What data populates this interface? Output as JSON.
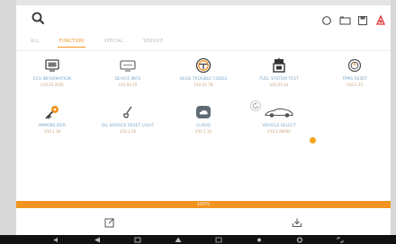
{
  "accent_color": "#f29422",
  "topbar": {
    "search_icon": "search-icon",
    "actions": [
      "refresh-icon",
      "folder-icon",
      "save-icon",
      "pdf-icon"
    ]
  },
  "tabs": [
    {
      "label": "ALL",
      "active": false
    },
    {
      "label": "FUNCTION",
      "active": true
    },
    {
      "label": "SPECIAL",
      "active": false
    },
    {
      "label": "SERVICE",
      "active": false
    }
  ],
  "tiles": [
    {
      "icon": "ecu-monitor-icon",
      "name": "ECU INFORMATION",
      "version": "V10.02 2045"
    },
    {
      "icon": "device-icon",
      "name": "DEVICE INFO",
      "version": "V10.00 25"
    },
    {
      "icon": "steering-wheel-icon",
      "name": "READ TROUBLE CODES",
      "version": "V10.01 78"
    },
    {
      "icon": "gas-station-icon",
      "name": "FUEL SYSTEM TEST",
      "version": "V10.01 64"
    },
    {
      "icon": "tpms-icon",
      "name": "TPMS RESET",
      "version": "V10.1 25"
    },
    {
      "icon": "key-icon",
      "name": "IMMOBILIZER",
      "version": "V10.1 18"
    },
    {
      "icon": "brush-icon",
      "name": "OIL SERVICE RESET LIGHT",
      "version": "V10.1 26"
    },
    {
      "icon": "cloud-icon",
      "name": "CLOUD",
      "version": "V10.1 10"
    },
    {
      "icon": "sports-car-icon",
      "name": "VEHICLE SELECT",
      "version": "V10.1 80000"
    }
  ],
  "progress": {
    "label": "100%",
    "fraction": 1.0
  },
  "bottombar": [
    "edit-icon",
    "download-icon"
  ],
  "navbar": [
    "volume-down-icon",
    "back-icon",
    "home-icon",
    "up-icon",
    "recent-apps-icon",
    "brightness-icon",
    "settings-icon",
    "screenshot-icon"
  ]
}
